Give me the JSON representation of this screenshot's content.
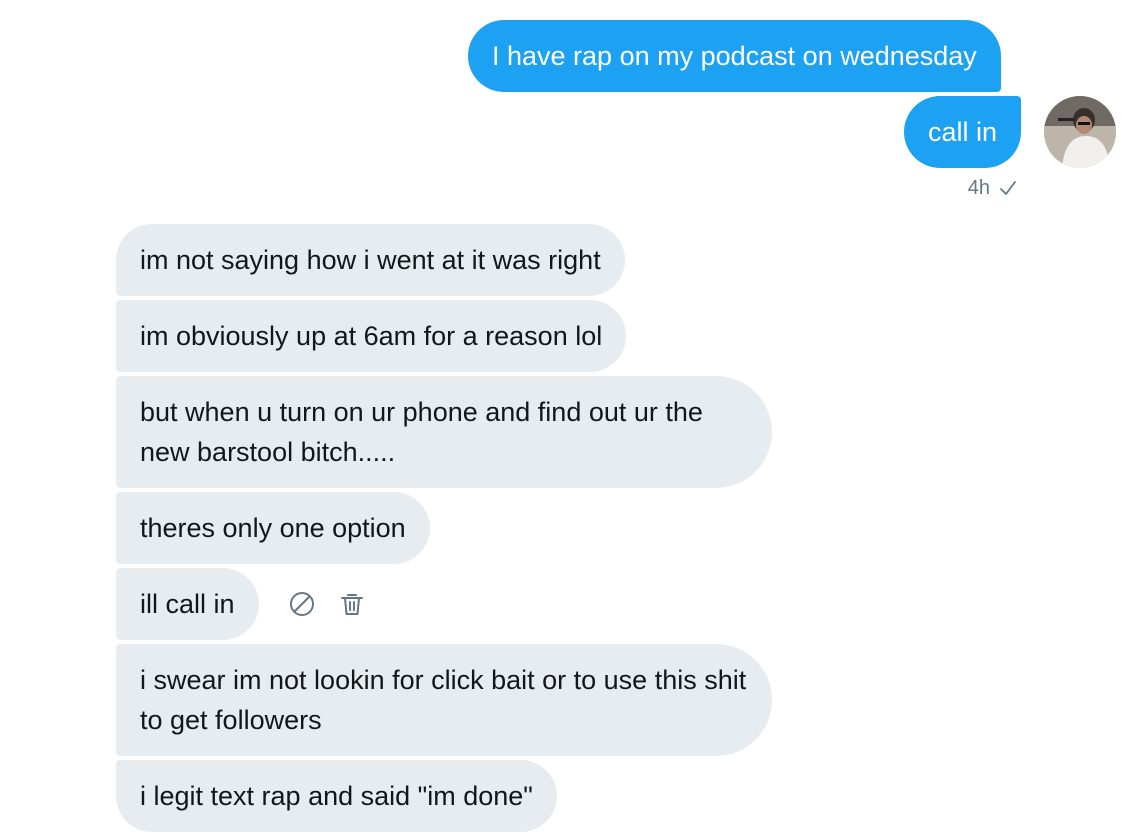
{
  "conversation": {
    "outgoing": [
      {
        "text": "I have rap on my podcast on wednesday"
      },
      {
        "text": "call in"
      }
    ],
    "outgoing_meta": {
      "time": "4h",
      "status_icon": "check-icon"
    },
    "incoming": [
      {
        "text": "im not saying how i went at it was right"
      },
      {
        "text": "im obviously up at 6am for a reason lol"
      },
      {
        "text": "but when u turn on ur phone and find out ur the new barstool bitch....."
      },
      {
        "text": "theres only one option"
      },
      {
        "text": "ill call in"
      },
      {
        "text": "i swear im not lookin for click bait or to use this shit to get followers"
      },
      {
        "text": "i legit text rap and said \"im done\""
      }
    ],
    "message_actions": {
      "icons": [
        "report-icon",
        "delete-icon"
      ]
    }
  },
  "colors": {
    "outgoing_bubble": "#1da1f2",
    "incoming_bubble": "#e6ecf0",
    "meta_text": "#657786"
  }
}
